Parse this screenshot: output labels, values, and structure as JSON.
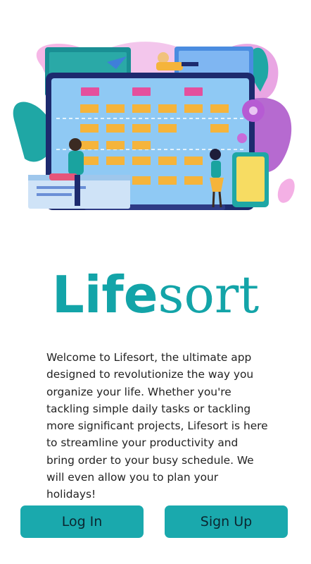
{
  "brand": {
    "bold": "Life",
    "light": "sort",
    "color": "#13a4a8"
  },
  "hero": {
    "icon": "productivity-illustration"
  },
  "description": "Welcome to Lifesort, the ultimate app designed to revolutionize the way you organize your life. Whether you're tackling simple daily tasks or tackling more significant projects, Lifesort is here to streamline your productivity and bring order to your busy schedule. We will even allow you to plan your holidays!",
  "actions": {
    "login": "Log In",
    "signup": "Sign Up",
    "button_color": "#1aa9ad"
  }
}
